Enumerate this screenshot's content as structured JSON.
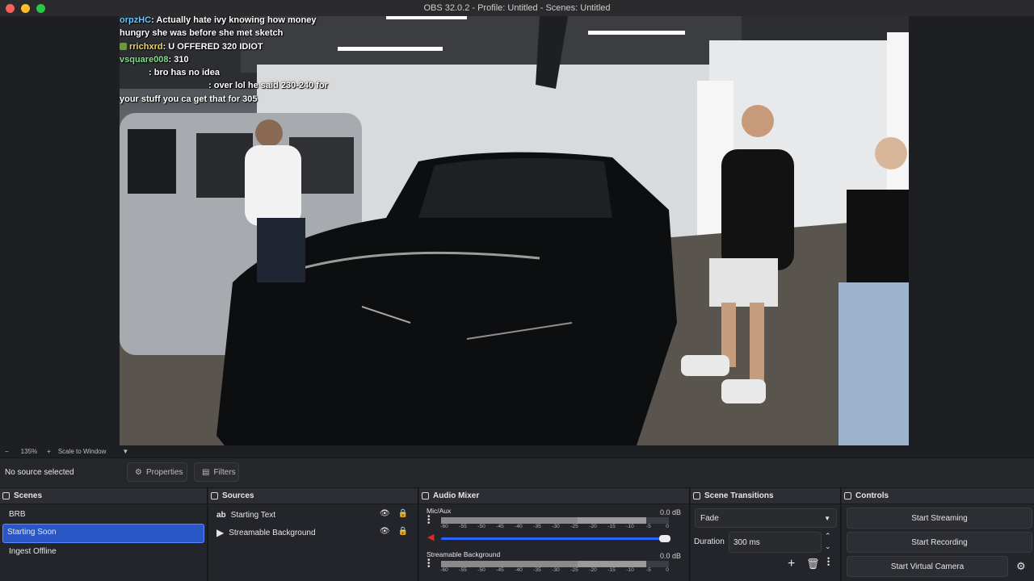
{
  "window": {
    "title": "OBS 32.0.2 - Profile: Untitled - Scenes: Untitled"
  },
  "chat": [
    {
      "user": "orpzHC",
      "user_color": "#6ec6ff",
      "message": ": Actually hate ivy knowing how money"
    },
    {
      "user": "",
      "user_color": "#ffffff",
      "message": "hungry she was before she met sketch"
    },
    {
      "user": "rrichxrd",
      "user_color": "#f0d36a",
      "message": ": U OFFERED 320 IDIOT"
    },
    {
      "user": "vsquare008",
      "user_color": "#7fe08a",
      "message": ": 310"
    },
    {
      "user": "",
      "user_color": "#ffffff",
      "message": ": bro has no idea"
    },
    {
      "user": "",
      "user_color": "#ff7a2a",
      "message": ": over lol he said 230-240 for"
    },
    {
      "user": "",
      "user_color": "#ffffff",
      "message": "your stuff you ca get that for 305"
    }
  ],
  "zoom": {
    "minus": "−",
    "level": "135%",
    "plus": "+",
    "mode": "Scale to Window"
  },
  "source_toolbar": {
    "status": "No source selected",
    "properties": "Properties",
    "filters": "Filters"
  },
  "scenes": {
    "title": "Scenes",
    "items": [
      {
        "label": "BRB",
        "selected": false
      },
      {
        "label": "Starting Soon",
        "selected": true
      },
      {
        "label": "Ingest Offline",
        "selected": false
      }
    ]
  },
  "sources": {
    "title": "Sources",
    "items": [
      {
        "label": "Starting Text",
        "icon": "text-icon"
      },
      {
        "label": "Streamable Background",
        "icon": "play-icon"
      }
    ]
  },
  "audio_mixer": {
    "title": "Audio Mixer",
    "ticks": [
      "-60",
      "-55",
      "-50",
      "-45",
      "-40",
      "-35",
      "-30",
      "-25",
      "-20",
      "-15",
      "-10",
      "-5",
      "0"
    ],
    "channels": [
      {
        "name": "Mic/Aux",
        "db": "0.0 dB",
        "muted": true
      },
      {
        "name": "Streamable Background",
        "db": "0.0 dB",
        "muted": false
      }
    ]
  },
  "transitions": {
    "title": "Scene Transitions",
    "selected": "Fade",
    "duration_label": "Duration",
    "duration_value": "300 ms"
  },
  "controls": {
    "title": "Controls",
    "start_streaming": "Start Streaming",
    "start_recording": "Start Recording",
    "start_virtual_camera": "Start Virtual Camera"
  },
  "colors": {
    "accent": "#2a56c6",
    "muted": "#e02a2a"
  }
}
